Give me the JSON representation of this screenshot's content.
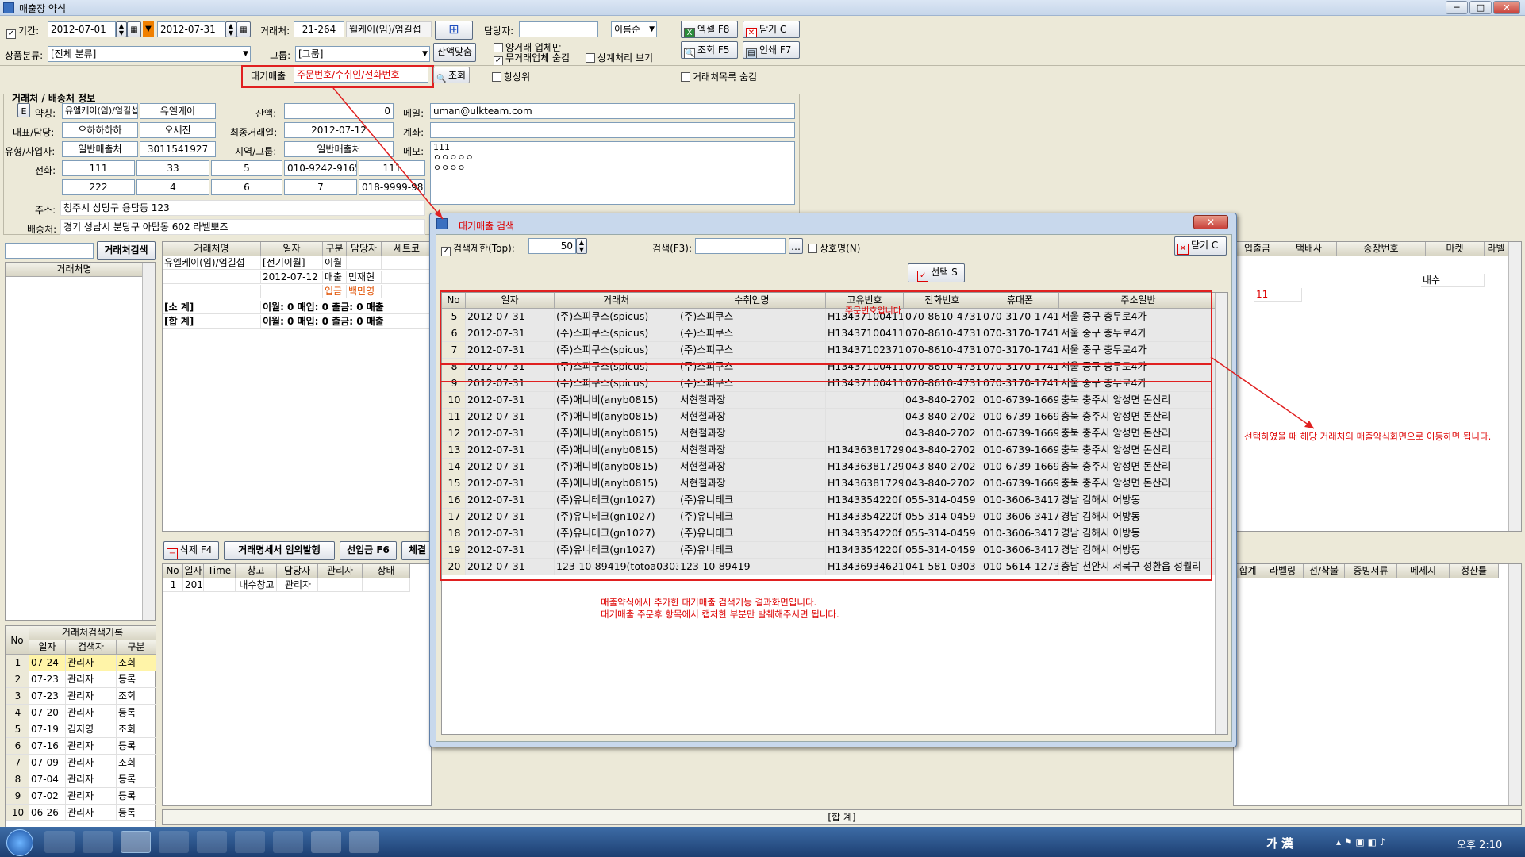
{
  "window": {
    "title": "매출장 약식",
    "title_extra": "… (주)스피쿠스 매출장 약식 매출 주문 …"
  },
  "toolbar": {
    "period_label": "기간:",
    "date_from": "2012-07-01",
    "date_to": "2012-07-31",
    "client_label": "거래처:",
    "client_code": "21-264",
    "client_name": "웰케이(임)/엄길섭",
    "manager_label": "담당자:",
    "sort_value": "이름순",
    "category_label": "상품분류:",
    "category_value": "[전체 분류]",
    "group_label": "그룹:",
    "group_value": "[그룹]",
    "balance_btn": "잔액맞춤",
    "chk_both": "양거래 업체만",
    "chk_no_trade": "무거래업체 숨김",
    "chk_offset": "상계처리 보기",
    "chk_top": "항상위",
    "chk_hide_list": "거래처목록 숨김",
    "excel_btn": "엑셀 F8",
    "close_btn": "닫기 C",
    "search_btn": "조회 F5",
    "print_btn": "인쇄 F7",
    "pending_label": "대기매출",
    "pending_placeholder": "주문번호/수취인/전화번호",
    "query_btn": "조회"
  },
  "info": {
    "section_title": "거래처 / 배송처 정보",
    "e_btn": "E",
    "name_label": "약칭:",
    "name1": "유엘케이(임)/엄길섭",
    "name2": "유엘케이",
    "balance_label": "잔액:",
    "balance": "0",
    "email_label": "메일:",
    "email": "uman@ulkteam.com",
    "rep_label": "대표/담당:",
    "rep1": "으하하하하",
    "rep2": "오세진",
    "lastdate_label": "최종거래일:",
    "lastdate": "2012-07-12",
    "account_label": "계좌:",
    "type_label": "유형/사업자:",
    "type1": "일반매출처",
    "bizno": "3011541927",
    "region_label": "지역/그룹:",
    "region": "일반매출처",
    "memo_label": "메모:",
    "memo": "111\nㅇㅇㅇㅇㅇ\nㅇㅇㅇㅇ",
    "phone_label": "전화:",
    "phones_row1": [
      "111",
      "33",
      "5",
      "010-9242-9165",
      "111"
    ],
    "phones_row2": [
      "222",
      "4",
      "6",
      "7",
      "018-9999-9898"
    ],
    "addr_label": "주소:",
    "addr": "청주시 상당구 용담동 123",
    "ship_label": "배송처:",
    "ship": "경기 성남시 분당구 아탑동 602 라벨뽀즈"
  },
  "left": {
    "search_btn": "거래처검색",
    "list_header": "거래처명",
    "history_title": "거래처검색기록",
    "history_headers": [
      "No",
      "일자",
      "검색자",
      "구분"
    ],
    "history": [
      [
        "1",
        "07-24",
        "관리자",
        "조회"
      ],
      [
        "2",
        "07-23",
        "관리자",
        "등록"
      ],
      [
        "3",
        "07-23",
        "관리자",
        "조회"
      ],
      [
        "4",
        "07-20",
        "관리자",
        "등록"
      ],
      [
        "5",
        "07-19",
        "김지영",
        "조회"
      ],
      [
        "6",
        "07-16",
        "관리자",
        "등록"
      ],
      [
        "7",
        "07-09",
        "관리자",
        "조회"
      ],
      [
        "8",
        "07-04",
        "관리자",
        "등록"
      ],
      [
        "9",
        "07-02",
        "관리자",
        "등록"
      ],
      [
        "10",
        "06-26",
        "관리자",
        "등록"
      ]
    ]
  },
  "main": {
    "headers": [
      "거래처명",
      "일자",
      "구분",
      "담당자",
      "세트코"
    ],
    "row1": [
      "유엘케이(임)/엄길섭",
      "[전기이월]",
      "이월",
      "",
      ""
    ],
    "row2": [
      "",
      "2012-07-12",
      "매출",
      "민재현",
      ""
    ],
    "row3": [
      "",
      "",
      "입금",
      "백민영",
      ""
    ],
    "subtotal_label": "[소 계]",
    "subtotal": "이월: 0   매입: 0   출금: 0   매출",
    "total_label": "[합 계]",
    "total": "이월: 0   매입: 0   출금: 0   매출",
    "right_headers": [
      "입출금",
      "택배사",
      "송장번호",
      "마켓",
      "라벨"
    ],
    "right_cell_red": "11",
    "right_cell_market": "내수",
    "bottom_btns": [
      "삭제 F4",
      "거래명세서 임의발행",
      "선입금 F6",
      "체결"
    ],
    "bottom_headers": [
      "No",
      "일자",
      "Time",
      "창고",
      "담당자",
      "관리자",
      "상태"
    ],
    "bottom_row": [
      "1",
      "201",
      "",
      "내수창고",
      "관리자",
      "",
      ""
    ],
    "bottom_right_headers": [
      "합계",
      "라벨링",
      "선/착불",
      "증빙서류",
      "메세지",
      "정산률"
    ],
    "sum_label": "[합 계]"
  },
  "dialog": {
    "title": "대기매출 검색",
    "limit_label": "검색제한(Top):",
    "limit_value": "50",
    "search_label": "검색(F3):",
    "chk_name": "상호명(N)",
    "close_btn": "닫기 C",
    "select_btn": "선택 S",
    "headers": [
      "No",
      "일자",
      "거래처",
      "수취인명",
      "고유번호",
      "전화번호",
      "휴대폰",
      "주소일반"
    ],
    "rows": [
      [
        "5",
        "2012-07-31",
        "(주)스피쿠스(spicus)",
        "(주)스피쿠스",
        "H134371004115",
        "070-8610-4731",
        "070-3170-1741",
        "서울 중구 충무로4가"
      ],
      [
        "6",
        "2012-07-31",
        "(주)스피쿠스(spicus)",
        "(주)스피쿠스",
        "H134371004115",
        "070-8610-4731",
        "070-3170-1741",
        "서울 중구 충무로4가"
      ],
      [
        "7",
        "2012-07-31",
        "(주)스피쿠스(spicus)",
        "(주)스피쿠스",
        "H134371023715",
        "070-8610-4731",
        "070-3170-1741",
        "서울 중구 충무로4가"
      ],
      [
        "8",
        "2012-07-31",
        "(주)스피쿠스(spicus)",
        "(주)스피쿠스",
        "H134371004115",
        "070-8610-4731",
        "070-3170-1741",
        "서울 중구 충무로4가"
      ],
      [
        "9",
        "2012-07-31",
        "(주)스피쿠스(spicus)",
        "(주)스피쿠스",
        "H134371004115",
        "070-8610-4731",
        "070-3170-1741",
        "서울 중구 충무로4가"
      ],
      [
        "10",
        "2012-07-31",
        "(주)애니비(anyb0815)",
        "서현철과장",
        "",
        "043-840-2702",
        "010-6739-1669",
        "충북 충주시 앙성면 돈산리"
      ],
      [
        "11",
        "2012-07-31",
        "(주)애니비(anyb0815)",
        "서현철과장",
        "",
        "043-840-2702",
        "010-6739-1669",
        "충북 충주시 앙성면 돈산리"
      ],
      [
        "12",
        "2012-07-31",
        "(주)애니비(anyb0815)",
        "서현철과장",
        "",
        "043-840-2702",
        "010-6739-1669",
        "충북 충주시 앙성면 돈산리"
      ],
      [
        "13",
        "2012-07-31",
        "(주)애니비(anyb0815)",
        "서현철과장",
        "H13436381729d",
        "043-840-2702",
        "010-6739-1669",
        "충북 충주시 앙성면 돈산리"
      ],
      [
        "14",
        "2012-07-31",
        "(주)애니비(anyb0815)",
        "서현철과장",
        "H13436381729d",
        "043-840-2702",
        "010-6739-1669",
        "충북 충주시 앙성면 돈산리"
      ],
      [
        "15",
        "2012-07-31",
        "(주)애니비(anyb0815)",
        "서현철과장",
        "H13436381729d",
        "043-840-2702",
        "010-6739-1669",
        "충북 충주시 앙성면 돈산리"
      ],
      [
        "16",
        "2012-07-31",
        "(주)유니테크(gn1027)",
        "(주)유니테크",
        "H1343354220f",
        "055-314-0459",
        "010-3606-3417",
        "경남 김해시 어방동"
      ],
      [
        "17",
        "2012-07-31",
        "(주)유니테크(gn1027)",
        "(주)유니테크",
        "H1343354220f",
        "055-314-0459",
        "010-3606-3417",
        "경남 김해시 어방동"
      ],
      [
        "18",
        "2012-07-31",
        "(주)유니테크(gn1027)",
        "(주)유니테크",
        "H1343354220f",
        "055-314-0459",
        "010-3606-3417",
        "경남 김해시 어방동"
      ],
      [
        "19",
        "2012-07-31",
        "(주)유니테크(gn1027)",
        "(주)유니테크",
        "H1343354220f",
        "055-314-0459",
        "010-3606-3417",
        "경남 김해시 어방동"
      ],
      [
        "20",
        "2012-07-31",
        "123-10-89419(totoa0303)",
        "123-10-89419",
        "H134369346216",
        "041-581-0303",
        "010-5614-1273",
        "충남 천안시 서북구 성환읍 성월리"
      ]
    ],
    "note_unique": "주문번호입니다",
    "note_bottom_1": "매출약식에서 추가한 대기매출 검색기능 결과화면입니다.",
    "note_bottom_2": "대기매출 주문후 항목에서 캡처한 부분만 발췌해주시면 됩니다."
  },
  "annotation_right": "선택하였을 때 해당 거래처의 매출약식화면으로 이동하면 됩니다.",
  "taskbar": {
    "ime": "가 漢",
    "clock": "오후 2:10"
  }
}
